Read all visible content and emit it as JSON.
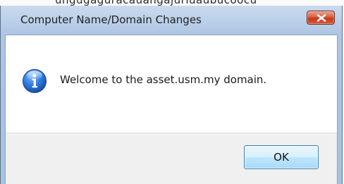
{
  "window": {
    "title": "Computer Name/Domain Changes",
    "close_icon": "close-icon"
  },
  "message": {
    "icon": "info-icon",
    "text": "Welcome to the asset.usm.my domain."
  },
  "buttons": {
    "ok_label": "OK"
  },
  "colors": {
    "title_bar": "#b9cfe9",
    "close_button": "#c5391b",
    "info_icon": "#2a6fd0",
    "button_area": "#f0f0f0",
    "ok_border": "#3c7fb1"
  }
}
